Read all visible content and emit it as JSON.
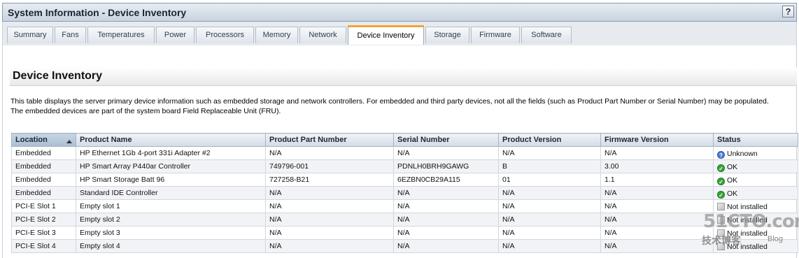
{
  "window": {
    "title": "System Information - Device Inventory",
    "help_label": "?"
  },
  "tabs": [
    {
      "label": "Summary"
    },
    {
      "label": "Fans"
    },
    {
      "label": "Temperatures"
    },
    {
      "label": "Power"
    },
    {
      "label": "Processors"
    },
    {
      "label": "Memory"
    },
    {
      "label": "Network"
    },
    {
      "label": "Device Inventory",
      "active": true
    },
    {
      "label": "Storage"
    },
    {
      "label": "Firmware"
    },
    {
      "label": "Software"
    }
  ],
  "section": {
    "heading": "Device Inventory",
    "description_line1": "This table displays the server primary device information such as embedded storage and network controllers. For embedded and third party devices, not all the fields (such as Product Part Number or Serial Number) may be populated.",
    "description_line2": "The embedded devices are part of the system board Field Replaceable Unit (FRU)."
  },
  "table": {
    "columns": [
      "Location",
      "Product Name",
      "Product Part Number",
      "Serial Number",
      "Product Version",
      "Firmware Version",
      "Status"
    ],
    "rows": [
      {
        "location": "Embedded",
        "product_name": "HP Ethernet 1Gb 4-port 331i Adapter #2",
        "part_number": "N/A",
        "serial": "N/A",
        "product_version": "N/A",
        "firmware_version": "N/A",
        "status": "Unknown",
        "status_icon": "unknown-icon"
      },
      {
        "location": "Embedded",
        "product_name": "HP Smart Array P440ar Controller",
        "part_number": "749796-001",
        "serial": "PDNLH0BRH9GAWG",
        "product_version": "B",
        "firmware_version": "3.00",
        "status": "OK",
        "status_icon": "ok-icon"
      },
      {
        "location": "Embedded",
        "product_name": "HP Smart Storage Batt 96",
        "part_number": "727258-B21",
        "serial": "6EZBN0CB29A115",
        "product_version": "01",
        "firmware_version": "1.1",
        "status": "OK",
        "status_icon": "ok-icon"
      },
      {
        "location": "Embedded",
        "product_name": "Standard IDE Controller",
        "part_number": "N/A",
        "serial": "N/A",
        "product_version": "N/A",
        "firmware_version": "N/A",
        "status": "OK",
        "status_icon": "ok-icon"
      },
      {
        "location": "PCI-E Slot 1",
        "product_name": "Empty slot 1",
        "part_number": "N/A",
        "serial": "N/A",
        "product_version": "N/A",
        "firmware_version": "N/A",
        "status": "Not installed",
        "status_icon": "not-installed-icon"
      },
      {
        "location": "PCI-E Slot 2",
        "product_name": "Empty slot 2",
        "part_number": "N/A",
        "serial": "N/A",
        "product_version": "N/A",
        "firmware_version": "N/A",
        "status": "Not installed",
        "status_icon": "not-installed-icon"
      },
      {
        "location": "PCI-E Slot 3",
        "product_name": "Empty slot 3",
        "part_number": "N/A",
        "serial": "N/A",
        "product_version": "N/A",
        "firmware_version": "N/A",
        "status": "Not installed",
        "status_icon": "not-installed-icon"
      },
      {
        "location": "PCI-E Slot 4",
        "product_name": "Empty slot 4",
        "part_number": "N/A",
        "serial": "N/A",
        "product_version": "N/A",
        "firmware_version": "N/A",
        "status": "Not installed",
        "status_icon": "not-installed-icon"
      }
    ]
  },
  "watermark": {
    "main": "51CTO.com",
    "sub": "技术博客",
    "blog": "Blog"
  }
}
